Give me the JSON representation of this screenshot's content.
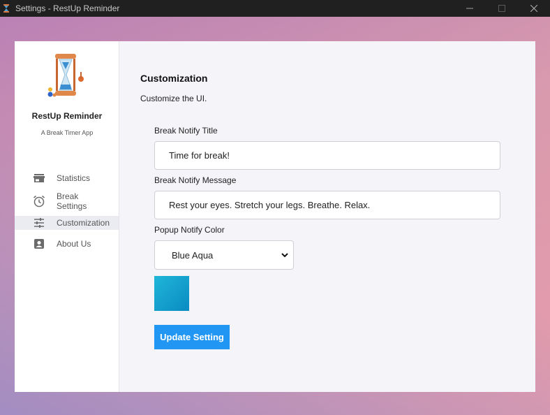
{
  "window": {
    "title": "Settings - RestUp Reminder"
  },
  "sidebar": {
    "app_name": "RestUp Reminder",
    "app_subtitle": "A Break Timer App",
    "items": [
      {
        "label": "Statistics",
        "icon": "store-icon"
      },
      {
        "label": "Break Settings",
        "icon": "alarm-clock-icon"
      },
      {
        "label": "Customization",
        "icon": "sliders-icon",
        "active": true
      },
      {
        "label": "About Us",
        "icon": "contact-card-icon"
      }
    ]
  },
  "main": {
    "title": "Customization",
    "description": "Customize the UI.",
    "fields": {
      "notify_title_label": "Break Notify Title",
      "notify_title_value": "Time for break!",
      "notify_message_label": "Break Notify Message",
      "notify_message_value": "Rest your eyes. Stretch your legs. Breathe. Relax.",
      "popup_color_label": "Popup Notify Color",
      "popup_color_value": "Blue Aqua"
    },
    "swatch_color": "#12a4cf",
    "update_button": "Update Setting"
  },
  "colors": {
    "accent": "#2196f3",
    "titlebar": "#202020"
  }
}
